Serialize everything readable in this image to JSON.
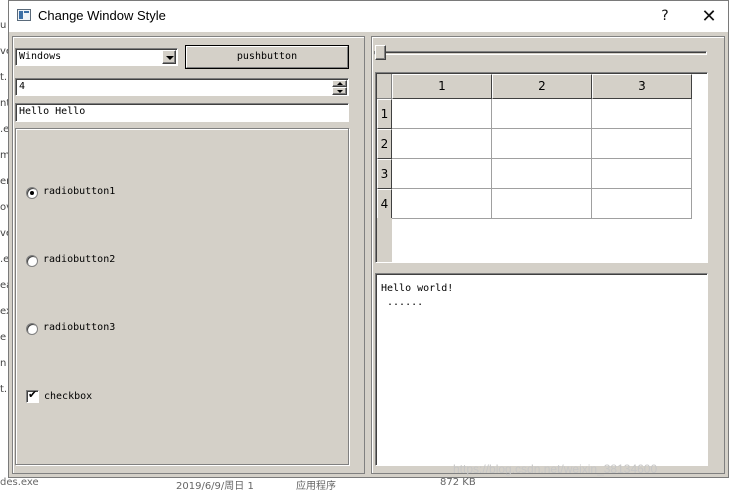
{
  "window": {
    "title": "Change Window Style",
    "help_label": "?",
    "close_label": "✕"
  },
  "background_app": {
    "left_chars": [
      "u",
      "ve",
      "t.",
      "nt",
      ".e",
      "m",
      "er",
      "ov",
      "ve",
      ".e",
      "ea",
      "ex",
      "e",
      "n",
      "t."
    ],
    "bottom_items": [
      "des.exe",
      "2019/6/9/周日 1",
      "应用程序",
      "872 KB"
    ]
  },
  "controls": {
    "combo_value": "Windows",
    "pushbutton_label": "pushbutton",
    "spinbox_value": "4",
    "lineedit_value": "Hello Hello",
    "radios": [
      {
        "label": "radiobutton1",
        "checked": true
      },
      {
        "label": "radiobutton2",
        "checked": false
      },
      {
        "label": "radiobutton3",
        "checked": false
      }
    ],
    "checkbox_label": "checkbox",
    "checkbox_checked": true,
    "slider_value": 0
  },
  "table": {
    "columns": [
      "1",
      "2",
      "3"
    ],
    "rows": [
      "1",
      "2",
      "3",
      "4"
    ]
  },
  "textedit": {
    "line1": "Hello world!",
    "line2": " ......"
  },
  "watermark": "https://blog.csdn.net/weixin_38134600"
}
